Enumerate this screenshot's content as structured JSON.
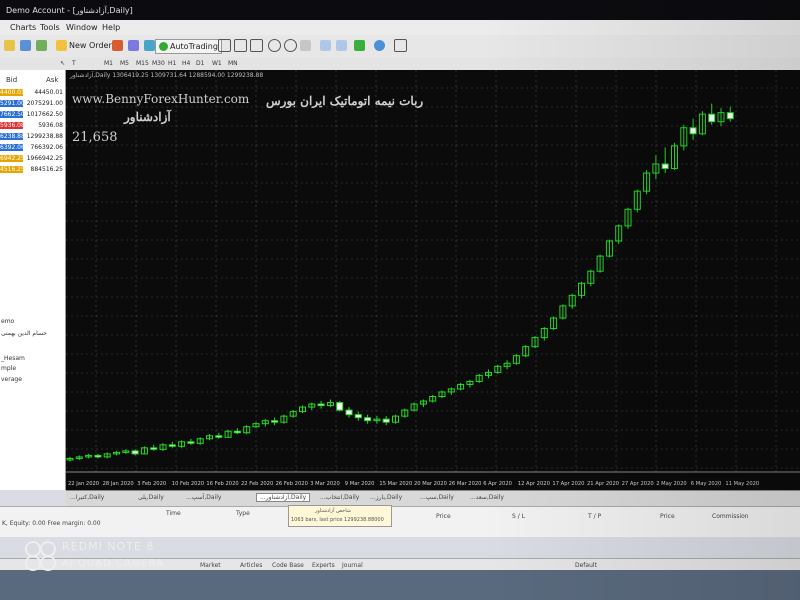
{
  "titlebar": {
    "title": "Demo Account - [آزادشناور,Daily]"
  },
  "menu": {
    "items": [
      "Charts",
      "Tools",
      "Window",
      "Help"
    ]
  },
  "toolbar": {
    "new_order": "New Order",
    "autotrading": "AutoTrading"
  },
  "timeframes": [
    "M1",
    "M5",
    "M15",
    "M30",
    "H1",
    "H4",
    "D1",
    "W1",
    "MN"
  ],
  "market_watch": {
    "bid_header": "Bid",
    "ask_header": "Ask",
    "rows": [
      {
        "bid": "4400.01",
        "ask": "44450.01"
      },
      {
        "bid": "5291.00",
        "ask": "2075291.00"
      },
      {
        "bid": "7662.50",
        "ask": "1017662.50"
      },
      {
        "bid": "5936.08",
        "ask": "5936.08"
      },
      {
        "bid": "6238.88",
        "ask": "1299238.88"
      },
      {
        "bid": "6392.06",
        "ask": "766392.06"
      },
      {
        "bid": "6942.25",
        "ask": "1966942.25"
      },
      {
        "bid": "4516.25",
        "ask": "884516.25"
      }
    ],
    "row_colors": [
      "#e8a400",
      "#2b6fd6",
      "#2b6fd6",
      "#e03030",
      "#2b6fd6",
      "#2b6fd6",
      "#e8a400",
      "#e8a400"
    ]
  },
  "navigator": {
    "items": [
      "emo",
      "حسام الدین بهمنی",
      "_Hesam",
      "mple",
      "verage"
    ]
  },
  "chart": {
    "header": "آزادشناور,Daily  1306419.25 1309731.64 1288594.00 1299238.88",
    "watermark_url": "www.BennyForexHunter.com",
    "watermark_text": "ربات نیمه اتوماتیک ایران بورس",
    "symbol_label": "آزادشناور",
    "price_label": "21,658",
    "x_labels": [
      "22 Jan 2020",
      "28 Jan 2020",
      "3 Feb 2020",
      "10 Feb 2020",
      "16 Feb 2020",
      "22 Feb 2020",
      "26 Feb 2020",
      "3 Mar 2020",
      "9 Mar 2020",
      "15 Mar 2020",
      "20 Mar 2020",
      "26 Mar 2020",
      "6 Apr 2020",
      "12 Apr 2020",
      "17 Apr 2020",
      "21 Apr 2020",
      "27 Apr 2020",
      "2 May 2020",
      "6 May 2020",
      "11 May 2020"
    ]
  },
  "chart_tabs": [
    "...کتیرا,Daily",
    "پلی,Daily",
    "...آسپ,Daily",
    "...آزادشناور,Daily",
    "...انتخاب,Daily",
    "...بارز,Daily",
    "...سپ,Daily",
    "...سعد,Daily"
  ],
  "chart_tabs_active": 3,
  "tooltip": {
    "line1": "شاخص آزادشناور",
    "line2": "1063 bars, last price 1299238.88000"
  },
  "terminal": {
    "columns": [
      "Time",
      "Type",
      "Price",
      "S / L",
      "T / P",
      "Price",
      "Commission"
    ],
    "equity": "K, Equity: 0.00  Free margin: 0.00",
    "tabs": [
      "Market",
      "Articles",
      "Code Base",
      "Experts",
      "Journal"
    ],
    "right_text": "Default"
  },
  "photo_watermark": {
    "line1": "REDMI NOTE 8",
    "line2": "AI QUAD CAMERA"
  },
  "chart_data": {
    "type": "candlestick",
    "series_color_up": "#22dd22",
    "series_color_down": "#ffffff",
    "values": [
      [
        100,
        102,
        99,
        101
      ],
      [
        101,
        103,
        100,
        102
      ],
      [
        102,
        104,
        101,
        103
      ],
      [
        103,
        104,
        101,
        102
      ],
      [
        102,
        105,
        101,
        104
      ],
      [
        104,
        106,
        103,
        105
      ],
      [
        105,
        107,
        104,
        106
      ],
      [
        106,
        107,
        103,
        104
      ],
      [
        104,
        109,
        104,
        108
      ],
      [
        108,
        110,
        106,
        107
      ],
      [
        107,
        111,
        106,
        110
      ],
      [
        110,
        112,
        108,
        109
      ],
      [
        109,
        113,
        108,
        112
      ],
      [
        112,
        114,
        110,
        111
      ],
      [
        111,
        115,
        110,
        114
      ],
      [
        114,
        117,
        113,
        116
      ],
      [
        116,
        118,
        114,
        115
      ],
      [
        115,
        120,
        115,
        119
      ],
      [
        119,
        121,
        117,
        118
      ],
      [
        118,
        123,
        117,
        122
      ],
      [
        122,
        125,
        121,
        124
      ],
      [
        124,
        127,
        122,
        126
      ],
      [
        126,
        128,
        123,
        125
      ],
      [
        125,
        130,
        124,
        129
      ],
      [
        129,
        133,
        128,
        132
      ],
      [
        132,
        136,
        131,
        135
      ],
      [
        135,
        138,
        133,
        137
      ],
      [
        137,
        139,
        134,
        136
      ],
      [
        136,
        140,
        135,
        138
      ],
      [
        138,
        139,
        132,
        133
      ],
      [
        133,
        135,
        128,
        130
      ],
      [
        130,
        132,
        126,
        128
      ],
      [
        128,
        130,
        124,
        126
      ],
      [
        126,
        129,
        124,
        127
      ],
      [
        127,
        129,
        123,
        125
      ],
      [
        125,
        130,
        124,
        129
      ],
      [
        129,
        134,
        128,
        133
      ],
      [
        133,
        138,
        132,
        137
      ],
      [
        137,
        140,
        135,
        139
      ],
      [
        139,
        143,
        138,
        142
      ],
      [
        142,
        146,
        141,
        145
      ],
      [
        145,
        148,
        143,
        147
      ],
      [
        147,
        151,
        146,
        150
      ],
      [
        150,
        153,
        148,
        152
      ],
      [
        152,
        157,
        151,
        156
      ],
      [
        156,
        160,
        154,
        158
      ],
      [
        158,
        163,
        157,
        162
      ],
      [
        162,
        166,
        160,
        164
      ],
      [
        164,
        170,
        163,
        169
      ],
      [
        169,
        176,
        168,
        175
      ],
      [
        175,
        182,
        174,
        181
      ],
      [
        181,
        188,
        179,
        187
      ],
      [
        187,
        195,
        186,
        194
      ],
      [
        194,
        203,
        193,
        202
      ],
      [
        202,
        210,
        200,
        209
      ],
      [
        209,
        218,
        207,
        217
      ],
      [
        217,
        226,
        215,
        225
      ],
      [
        225,
        236,
        224,
        235
      ],
      [
        235,
        246,
        234,
        245
      ],
      [
        245,
        256,
        243,
        255
      ],
      [
        255,
        267,
        253,
        266
      ],
      [
        266,
        279,
        264,
        278
      ],
      [
        278,
        292,
        276,
        290
      ],
      [
        290,
        302,
        286,
        296
      ],
      [
        296,
        307,
        290,
        293
      ],
      [
        293,
        310,
        292,
        308
      ],
      [
        308,
        322,
        305,
        320
      ],
      [
        320,
        326,
        312,
        316
      ],
      [
        316,
        331,
        315,
        329
      ],
      [
        329,
        336,
        322,
        324
      ],
      [
        324,
        333,
        321,
        330
      ],
      [
        330,
        334,
        324,
        326
      ]
    ],
    "ylim": [
      92,
      345
    ]
  }
}
